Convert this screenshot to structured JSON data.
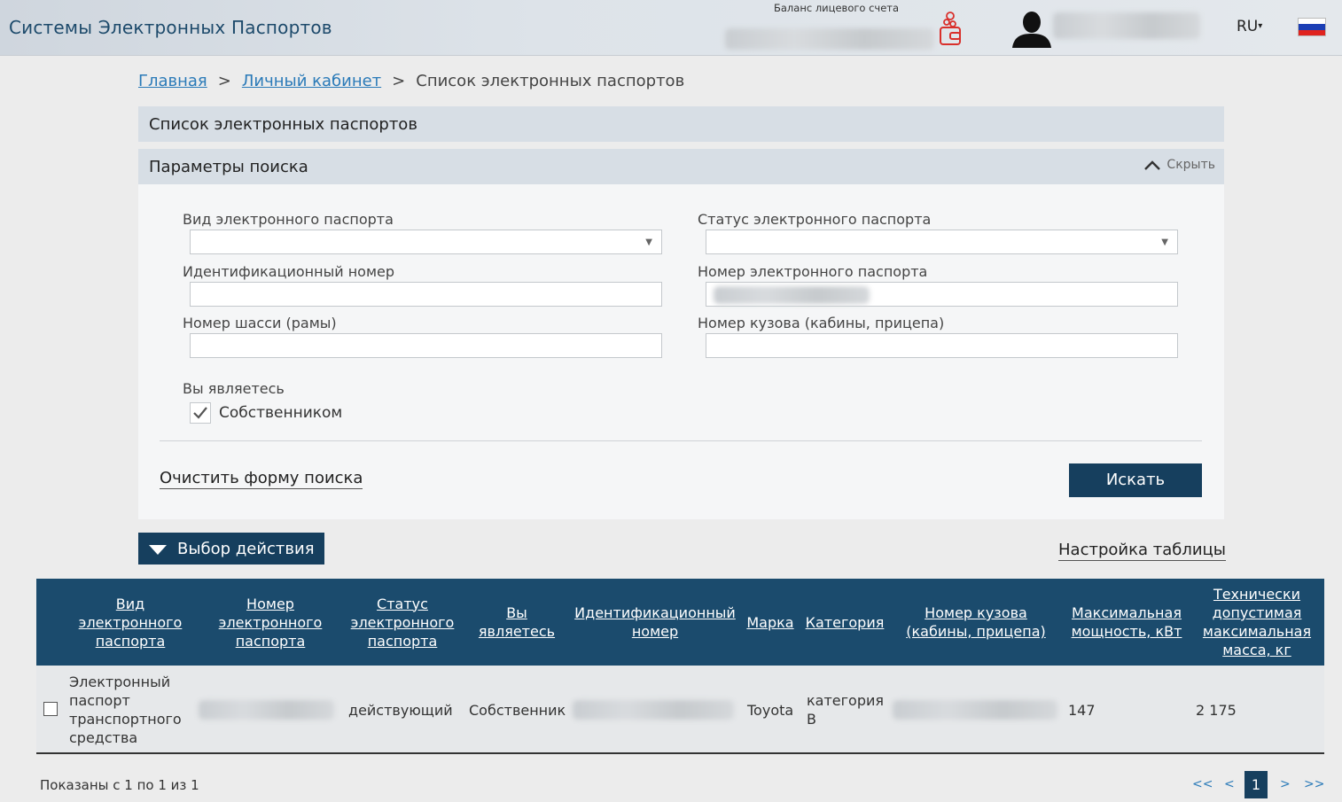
{
  "header": {
    "app_title": "Системы Электронных Паспортов",
    "balance_label": "Баланс лицевого счета",
    "lang": "RU",
    "icons": [
      "wallet-icon",
      "user-avatar-icon",
      "flag-ru-icon"
    ]
  },
  "breadcrumb": {
    "home": "Главная",
    "cabinet": "Личный кабинет",
    "current": "Список электронных паспортов",
    "separator": ">"
  },
  "page_title": "Список электронных паспортов",
  "search": {
    "title": "Параметры поиска",
    "hide_label": "Скрыть",
    "fields": {
      "passport_type_label": "Вид электронного паспорта",
      "passport_status_label": "Статус электронного паспорта",
      "id_number_label": "Идентификационный номер",
      "passport_number_label": "Номер электронного паспорта",
      "chassis_label": "Номер шасси (рамы)",
      "body_label": "Номер кузова (кабины, прицепа)"
    },
    "you_are_label": "Вы являетесь",
    "owner_checkbox_label": "Собственником",
    "owner_checked": true,
    "clear_label": "Очистить форму поиска",
    "search_button": "Искать"
  },
  "actions": {
    "select_action": "Выбор действия",
    "table_settings": "Настройка таблицы"
  },
  "table": {
    "headers": [
      "Вид электронного паспорта",
      "Номер электронного паспорта",
      "Статус электронного паспорта",
      "Вы являетесь",
      "Идентификационный номер",
      "Марка",
      "Категория",
      "Номер кузова (кабины, прицепа)",
      "Максимальная мощность, кВт",
      "Технически допустимая максимальная масса, кг"
    ],
    "rows": [
      {
        "type": "Электронный паспорт транспортного средства",
        "status": "действующий",
        "you_are": "Собственник",
        "brand": "Toyota",
        "category": "категория B",
        "power": "147",
        "mass": "2 175"
      }
    ]
  },
  "pagination": {
    "shown": "Показаны с 1 по 1 из 1",
    "first": "<<",
    "prev": "<",
    "current": "1",
    "next": ">",
    "last": ">>"
  },
  "colors": {
    "primary": "#163f5e",
    "table_header": "#1b4b6d",
    "link": "#2a7ab8",
    "panel_header": "#d7dee5"
  }
}
